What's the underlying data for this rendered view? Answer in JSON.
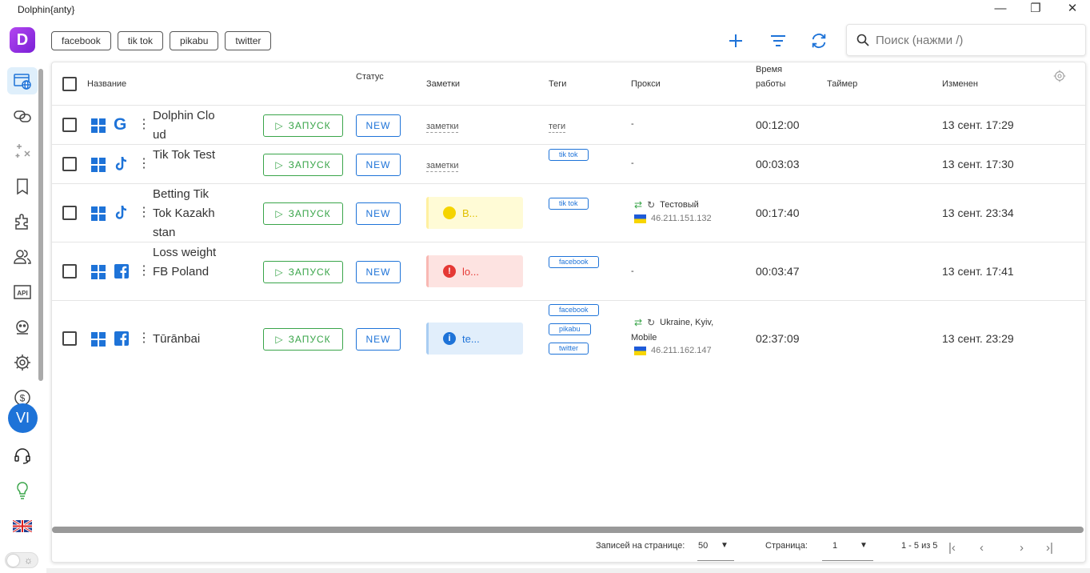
{
  "window": {
    "title": "Dolphin{anty}",
    "minimize": "—",
    "maximize": "❐",
    "close": "✕"
  },
  "sidebar": {
    "logo": "D",
    "items": [
      {
        "name": "browser-profiles-icon",
        "active": true
      },
      {
        "name": "link-icon"
      },
      {
        "name": "automation-icon"
      },
      {
        "name": "bookmark-icon"
      },
      {
        "name": "extensions-icon"
      },
      {
        "name": "users-icon"
      },
      {
        "name": "api-icon",
        "text": "API"
      },
      {
        "name": "robot-icon"
      },
      {
        "name": "settings-gear-icon"
      },
      {
        "name": "billing-dollar-icon"
      }
    ],
    "avatar": "VI",
    "support_icon": "headset-icon",
    "ideas_icon": "lightbulb-icon",
    "language_flag": "uk-flag-icon",
    "theme_toggle": "sun-icon"
  },
  "filters": {
    "chips": [
      "facebook",
      "tik tok",
      "pikabu",
      "twitter"
    ]
  },
  "toolbar": {
    "add_icon": "plus-icon",
    "filter_icon": "filter-icon",
    "refresh_icon": "refresh-icon"
  },
  "search": {
    "placeholder": "Поиск (нажми /)"
  },
  "table": {
    "headers": {
      "name": "Название",
      "status": "Статус",
      "notes": "Заметки",
      "tags": "Теги",
      "proxy": "Прокси",
      "uptime_line1": "Время",
      "uptime_line2": "работы",
      "timer": "Таймер",
      "modified": "Изменен"
    },
    "launch_label": "ЗАПУСК",
    "status_label": "NEW",
    "rows": [
      {
        "name": "Dolphin Cloud",
        "site_icon": "google-icon",
        "notes": "заметки",
        "tags_link": "теги",
        "proxy": "-",
        "uptime": "00:12:00",
        "modified": "13 сент. 17:29"
      },
      {
        "name": "Tik Tok Test",
        "site_icon": "tiktok-icon",
        "notes": "заметки",
        "tags": [
          "tik tok"
        ],
        "proxy": "-",
        "uptime": "00:03:03",
        "modified": "13 сент. 17:30"
      },
      {
        "name": "Betting Tik Tok Kazakhstan",
        "site_icon": "tiktok-icon",
        "note_card": "B...",
        "note_color": "#fffbd6",
        "note_dot": "#f5d400",
        "tags": [
          "tik tok"
        ],
        "proxy_name": "Тестовый",
        "proxy_ip": "46.211.151.132",
        "uptime": "00:17:40",
        "modified": "13 сент. 23:34"
      },
      {
        "name": "Loss weight FB Poland",
        "site_icon": "facebook-icon",
        "note_card": "lo...",
        "note_color": "#fde3e1",
        "note_dot": "#e53935",
        "tags": [
          "facebook"
        ],
        "proxy": "-",
        "uptime": "00:03:47",
        "modified": "13 сент. 17:41"
      },
      {
        "name": "Tūrānbai",
        "site_icon": "facebook-icon",
        "note_card": "te...",
        "note_color": "#e1eefb",
        "note_dot": "#1e73d8",
        "tags": [
          "facebook",
          "pikabu",
          "twitter"
        ],
        "proxy_name": "Ukraine, Kyiv,",
        "proxy_name2": "Mobile",
        "proxy_ip": "46.211.162.147",
        "uptime": "02:37:09",
        "modified": "13 сент. 23:29"
      }
    ]
  },
  "pagination": {
    "per_page_label": "Записей на странице:",
    "per_page_value": "50",
    "page_label": "Страница:",
    "page_value": "1",
    "range": "1 - 5 из 5"
  }
}
